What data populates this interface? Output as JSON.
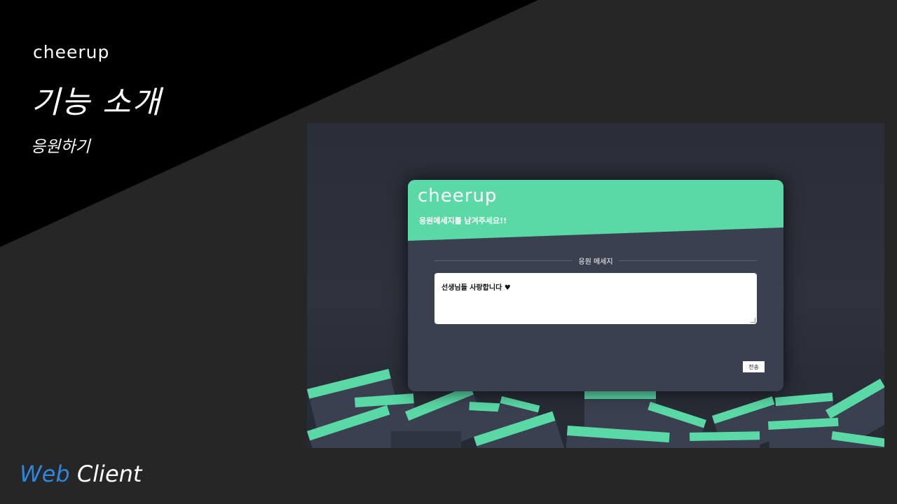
{
  "slide": {
    "logo": "cheerup",
    "title": "기능 소개",
    "subtitle": "응원하기",
    "footer_word1": "Web",
    "footer_word2": "Client"
  },
  "app": {
    "logo": "cheerup",
    "prompt": "응원메세지를 남겨주세요!!",
    "section_title": "응원 메세지",
    "message_value": "선생님들 사랑합니다 ♥",
    "send_label": "전송"
  },
  "colors": {
    "slide_bg": "#262626",
    "diagonal": "#000000",
    "accent_green": "#5ad8a6",
    "modal_bg": "#3a4050",
    "footer_blue": "#2e86de"
  }
}
